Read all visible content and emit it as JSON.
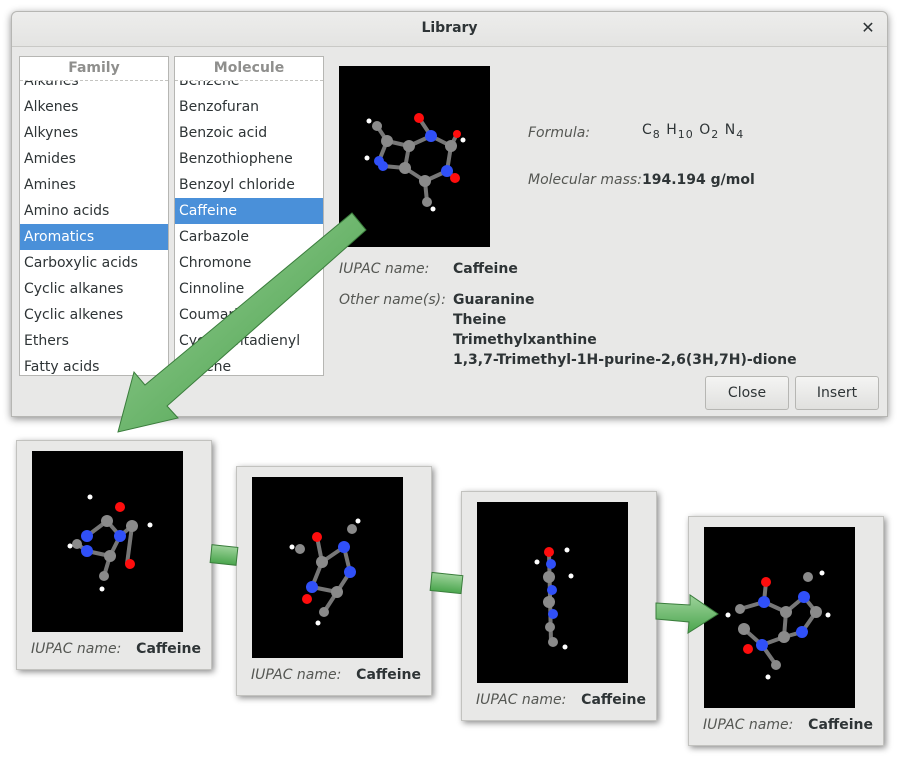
{
  "dialog": {
    "title": "Library",
    "close_icon": "✕",
    "family": {
      "header": "Family",
      "items": [
        "Alkanes",
        "Alkenes",
        "Alkynes",
        "Amides",
        "Amines",
        "Amino acids",
        "Aromatics",
        "Carboxylic acids",
        "Cyclic alkanes",
        "Cyclic alkenes",
        "Ethers",
        "Fatty acids"
      ],
      "selected": "Aromatics"
    },
    "molecule": {
      "header": "Molecule",
      "items": [
        "Benzene",
        "Benzofuran",
        "Benzoic acid",
        "Benzothiophene",
        "Benzoyl chloride",
        "Caffeine",
        "Carbazole",
        "Chromone",
        "Cinnoline",
        "Coumarin",
        "Cyclopentadienyl",
        "Florene"
      ],
      "selected": "Caffeine"
    },
    "formula_label": "Formula:",
    "formula": {
      "parts": [
        "C",
        "8",
        "H",
        "10",
        "O",
        "2",
        "N",
        "4"
      ]
    },
    "mass_label": "Molecular mass:",
    "mass_value": "194.194 g/mol",
    "iupac_label": "IUPAC name:",
    "iupac_value": "Caffeine",
    "other_label": "Other name(s):",
    "other_names": [
      "Guaranine",
      "Theine",
      "Trimethylxanthine",
      "1,3,7-Trimethyl-1H-purine-2,6(3H,7H)-dione"
    ],
    "buttons": {
      "close": "Close",
      "insert": "Insert"
    }
  },
  "cards": [
    {
      "label": "IUPAC name:",
      "value": "Caffeine"
    },
    {
      "label": "IUPAC name:",
      "value": "Caffeine"
    },
    {
      "label": "IUPAC name:",
      "value": "Caffeine"
    },
    {
      "label": "IUPAC name:",
      "value": "Caffeine"
    }
  ],
  "colors": {
    "selection": "#4a90d9",
    "arrow": "#5cb15c",
    "atom_carbon": "#8a8a8a",
    "atom_nitrogen": "#3050f8",
    "atom_oxygen": "#ff0d0d",
    "atom_hydrogen": "#ffffff"
  }
}
